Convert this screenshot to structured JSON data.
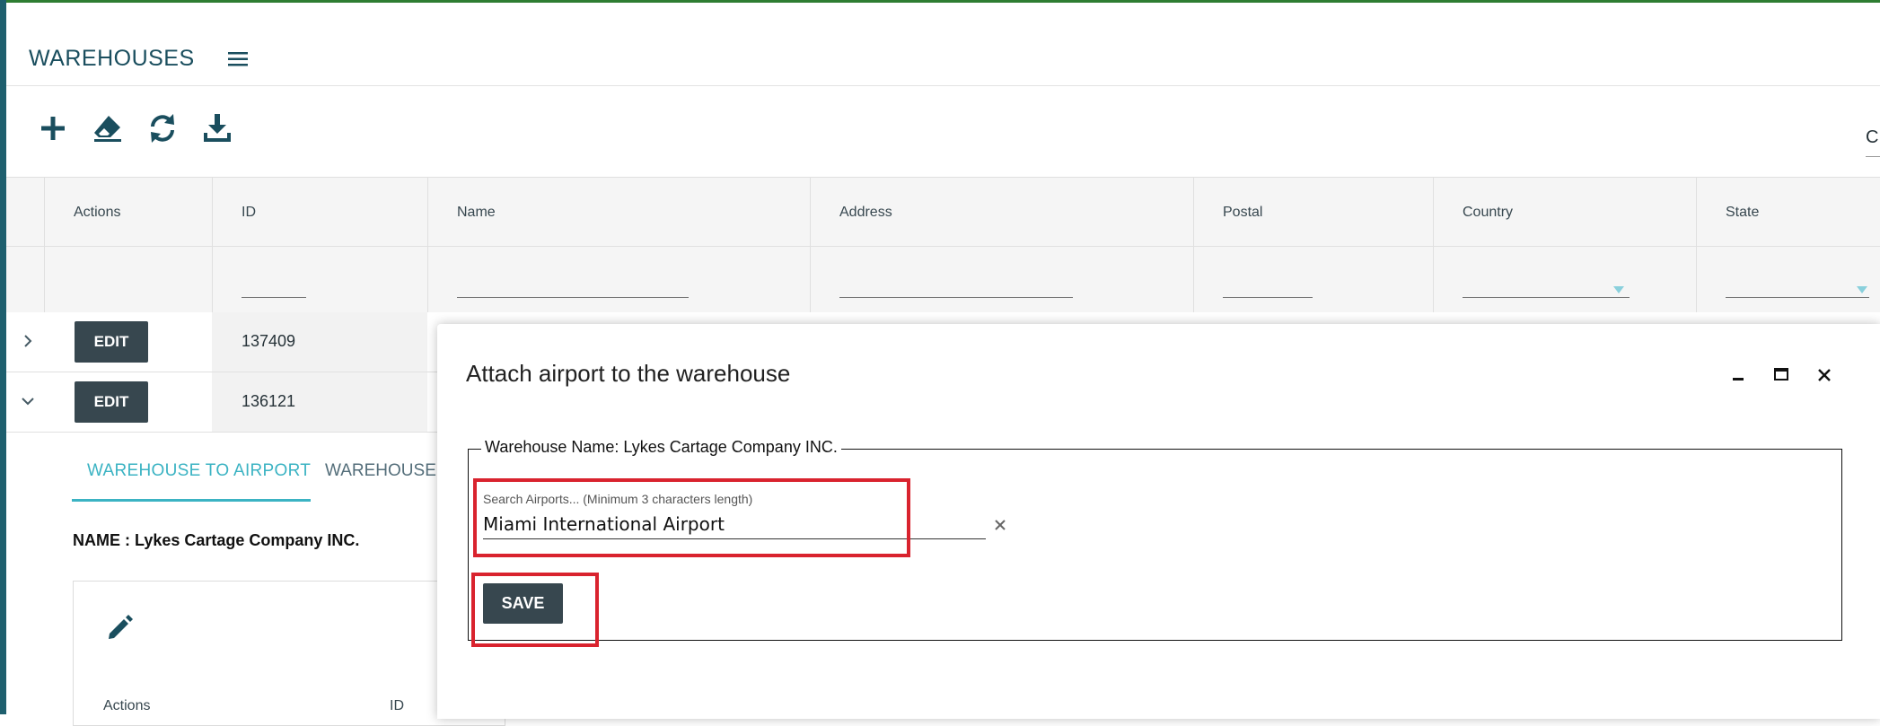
{
  "header": {
    "title": "WAREHOUSES"
  },
  "toolbar": {
    "icons": [
      "plus-icon",
      "eraser-icon",
      "refresh-icon",
      "download-icon"
    ]
  },
  "right_edge_text": "C",
  "grid": {
    "columns": [
      "Actions",
      "ID",
      "Name",
      "Address",
      "Postal",
      "Country",
      "State"
    ],
    "rows": [
      {
        "edit_label": "EDIT",
        "id": "137409",
        "expanded": false
      },
      {
        "edit_label": "EDIT",
        "id": "136121",
        "expanded": true
      }
    ]
  },
  "detail": {
    "tabs": [
      {
        "label": "WAREHOUSE TO AIRPORT",
        "active": true
      },
      {
        "label": "WAREHOUSE T",
        "active": false
      }
    ],
    "name_label": "NAME : Lykes Cartage Company INC.",
    "subgrid_columns": [
      "Actions",
      "ID"
    ]
  },
  "modal": {
    "title": "Attach airport to the warehouse",
    "fieldset_legend": "Warehouse Name: Lykes Cartage Company INC.",
    "search_label": "Search Airports... (Minimum 3 characters length)",
    "search_value": "Miami International Airport",
    "save_label": "SAVE"
  },
  "colors": {
    "primary_button": "#37474f",
    "accent": "#3bb3c3",
    "highlight": "#d9232e",
    "title": "#1a4e5e",
    "top_bar": "#2e7d32"
  }
}
